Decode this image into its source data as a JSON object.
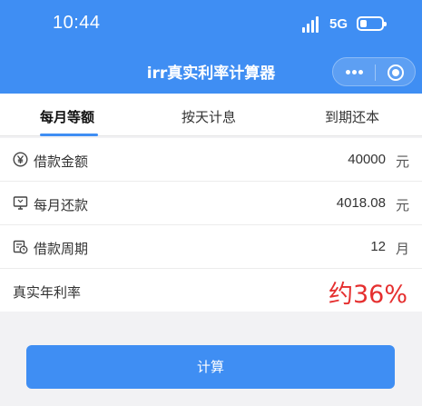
{
  "status_bar": {
    "time": "10:44",
    "network": "5G"
  },
  "header": {
    "title": "irr真实利率计算器"
  },
  "tabs": [
    {
      "label": "每月等额",
      "active": true
    },
    {
      "label": "按天计息",
      "active": false
    },
    {
      "label": "到期还本",
      "active": false
    }
  ],
  "form": {
    "loan_amount": {
      "label": "借款金额",
      "value": "40000",
      "unit": "元",
      "icon": "yen-icon"
    },
    "monthly_payment": {
      "label": "每月还款",
      "value": "4018.08",
      "unit": "元",
      "icon": "monitor-icon"
    },
    "loan_term": {
      "label": "借款周期",
      "value": "12",
      "unit": "月",
      "icon": "calendar-clock-icon"
    },
    "real_rate": {
      "label": "真实年利率",
      "value": "约36%"
    }
  },
  "actions": {
    "calculate_label": "计算"
  },
  "colors": {
    "accent": "#3f8ef3",
    "rate": "#e52f2f"
  }
}
